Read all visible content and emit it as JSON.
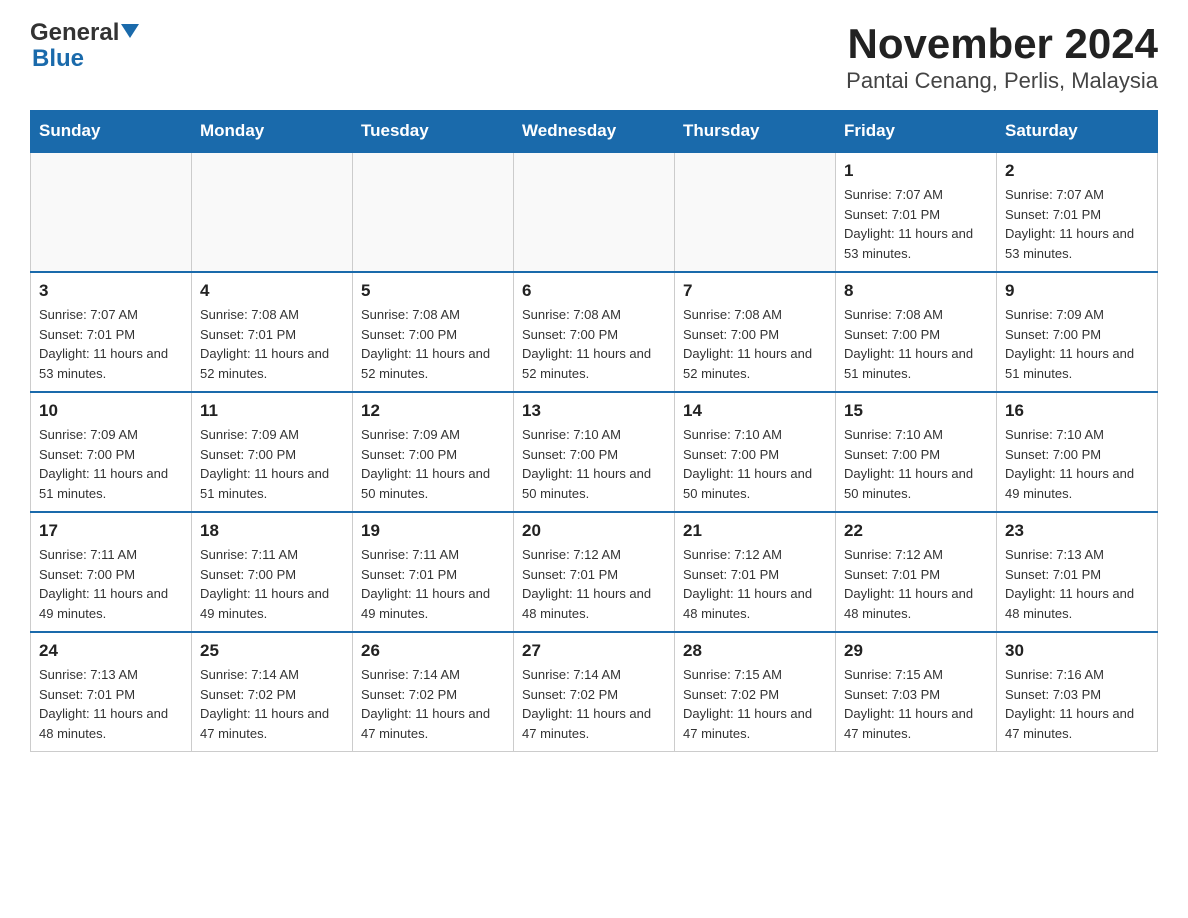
{
  "logo": {
    "general": "General",
    "blue": "Blue"
  },
  "title": "November 2024",
  "subtitle": "Pantai Cenang, Perlis, Malaysia",
  "weekdays": [
    "Sunday",
    "Monday",
    "Tuesday",
    "Wednesday",
    "Thursday",
    "Friday",
    "Saturday"
  ],
  "weeks": [
    [
      {
        "day": "",
        "info": ""
      },
      {
        "day": "",
        "info": ""
      },
      {
        "day": "",
        "info": ""
      },
      {
        "day": "",
        "info": ""
      },
      {
        "day": "",
        "info": ""
      },
      {
        "day": "1",
        "sunrise": "7:07 AM",
        "sunset": "7:01 PM",
        "daylight": "11 hours and 53 minutes."
      },
      {
        "day": "2",
        "sunrise": "7:07 AM",
        "sunset": "7:01 PM",
        "daylight": "11 hours and 53 minutes."
      }
    ],
    [
      {
        "day": "3",
        "sunrise": "7:07 AM",
        "sunset": "7:01 PM",
        "daylight": "11 hours and 53 minutes."
      },
      {
        "day": "4",
        "sunrise": "7:08 AM",
        "sunset": "7:01 PM",
        "daylight": "11 hours and 52 minutes."
      },
      {
        "day": "5",
        "sunrise": "7:08 AM",
        "sunset": "7:00 PM",
        "daylight": "11 hours and 52 minutes."
      },
      {
        "day": "6",
        "sunrise": "7:08 AM",
        "sunset": "7:00 PM",
        "daylight": "11 hours and 52 minutes."
      },
      {
        "day": "7",
        "sunrise": "7:08 AM",
        "sunset": "7:00 PM",
        "daylight": "11 hours and 52 minutes."
      },
      {
        "day": "8",
        "sunrise": "7:08 AM",
        "sunset": "7:00 PM",
        "daylight": "11 hours and 51 minutes."
      },
      {
        "day": "9",
        "sunrise": "7:09 AM",
        "sunset": "7:00 PM",
        "daylight": "11 hours and 51 minutes."
      }
    ],
    [
      {
        "day": "10",
        "sunrise": "7:09 AM",
        "sunset": "7:00 PM",
        "daylight": "11 hours and 51 minutes."
      },
      {
        "day": "11",
        "sunrise": "7:09 AM",
        "sunset": "7:00 PM",
        "daylight": "11 hours and 51 minutes."
      },
      {
        "day": "12",
        "sunrise": "7:09 AM",
        "sunset": "7:00 PM",
        "daylight": "11 hours and 50 minutes."
      },
      {
        "day": "13",
        "sunrise": "7:10 AM",
        "sunset": "7:00 PM",
        "daylight": "11 hours and 50 minutes."
      },
      {
        "day": "14",
        "sunrise": "7:10 AM",
        "sunset": "7:00 PM",
        "daylight": "11 hours and 50 minutes."
      },
      {
        "day": "15",
        "sunrise": "7:10 AM",
        "sunset": "7:00 PM",
        "daylight": "11 hours and 50 minutes."
      },
      {
        "day": "16",
        "sunrise": "7:10 AM",
        "sunset": "7:00 PM",
        "daylight": "11 hours and 49 minutes."
      }
    ],
    [
      {
        "day": "17",
        "sunrise": "7:11 AM",
        "sunset": "7:00 PM",
        "daylight": "11 hours and 49 minutes."
      },
      {
        "day": "18",
        "sunrise": "7:11 AM",
        "sunset": "7:00 PM",
        "daylight": "11 hours and 49 minutes."
      },
      {
        "day": "19",
        "sunrise": "7:11 AM",
        "sunset": "7:01 PM",
        "daylight": "11 hours and 49 minutes."
      },
      {
        "day": "20",
        "sunrise": "7:12 AM",
        "sunset": "7:01 PM",
        "daylight": "11 hours and 48 minutes."
      },
      {
        "day": "21",
        "sunrise": "7:12 AM",
        "sunset": "7:01 PM",
        "daylight": "11 hours and 48 minutes."
      },
      {
        "day": "22",
        "sunrise": "7:12 AM",
        "sunset": "7:01 PM",
        "daylight": "11 hours and 48 minutes."
      },
      {
        "day": "23",
        "sunrise": "7:13 AM",
        "sunset": "7:01 PM",
        "daylight": "11 hours and 48 minutes."
      }
    ],
    [
      {
        "day": "24",
        "sunrise": "7:13 AM",
        "sunset": "7:01 PM",
        "daylight": "11 hours and 48 minutes."
      },
      {
        "day": "25",
        "sunrise": "7:14 AM",
        "sunset": "7:02 PM",
        "daylight": "11 hours and 47 minutes."
      },
      {
        "day": "26",
        "sunrise": "7:14 AM",
        "sunset": "7:02 PM",
        "daylight": "11 hours and 47 minutes."
      },
      {
        "day": "27",
        "sunrise": "7:14 AM",
        "sunset": "7:02 PM",
        "daylight": "11 hours and 47 minutes."
      },
      {
        "day": "28",
        "sunrise": "7:15 AM",
        "sunset": "7:02 PM",
        "daylight": "11 hours and 47 minutes."
      },
      {
        "day": "29",
        "sunrise": "7:15 AM",
        "sunset": "7:03 PM",
        "daylight": "11 hours and 47 minutes."
      },
      {
        "day": "30",
        "sunrise": "7:16 AM",
        "sunset": "7:03 PM",
        "daylight": "11 hours and 47 minutes."
      }
    ]
  ]
}
